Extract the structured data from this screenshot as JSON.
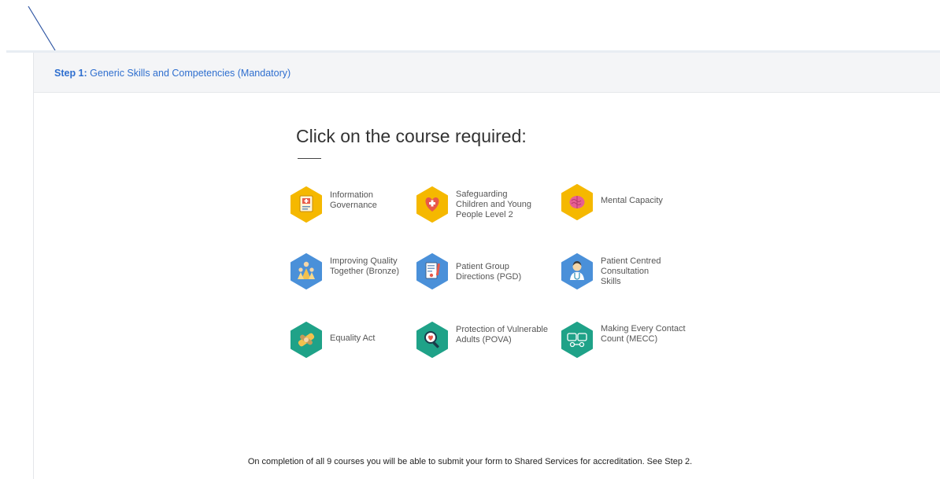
{
  "step": {
    "label": "Step 1:",
    "title": "Generic Skills and Competencies (Mandatory)"
  },
  "heading": "Click on the course required:",
  "courses": [
    {
      "label_lines": [
        "Information",
        "Governance"
      ],
      "icon": "id-card-icon",
      "color": "#f5b800"
    },
    {
      "label_lines": [
        "Safeguarding",
        "Children and Young",
        "People Level 2"
      ],
      "icon": "heart-cross-icon",
      "color": "#f5b800"
    },
    {
      "label_lines": [
        "Mental Capacity"
      ],
      "icon": "brain-icon",
      "color": "#f5b800"
    },
    {
      "label_lines": [
        "Improving Quality",
        "Together (Bronze)"
      ],
      "icon": "team-icon",
      "color": "#4a90d9"
    },
    {
      "label_lines": [
        "Patient Group",
        "Directions (PGD)"
      ],
      "icon": "document-pen-icon",
      "color": "#4a90d9"
    },
    {
      "label_lines": [
        "Patient Centred",
        "Consultation",
        "Skills"
      ],
      "icon": "doctor-icon",
      "color": "#4a90d9"
    },
    {
      "label_lines": [
        "Equality Act"
      ],
      "icon": "handshake-icon",
      "color": "#1fa288"
    },
    {
      "label_lines": [
        "Protection of Vulnerable",
        "Adults (POVA)"
      ],
      "icon": "magnifier-heart-icon",
      "color": "#1fa288"
    },
    {
      "label_lines": [
        "Making Every Contact",
        "Count (MECC)"
      ],
      "icon": "speech-bubbles-icon",
      "color": "#1fa288"
    }
  ],
  "footer_note": "On completion of all 9 courses you will be able to submit your form to Shared Services for accreditation. See Step 2."
}
